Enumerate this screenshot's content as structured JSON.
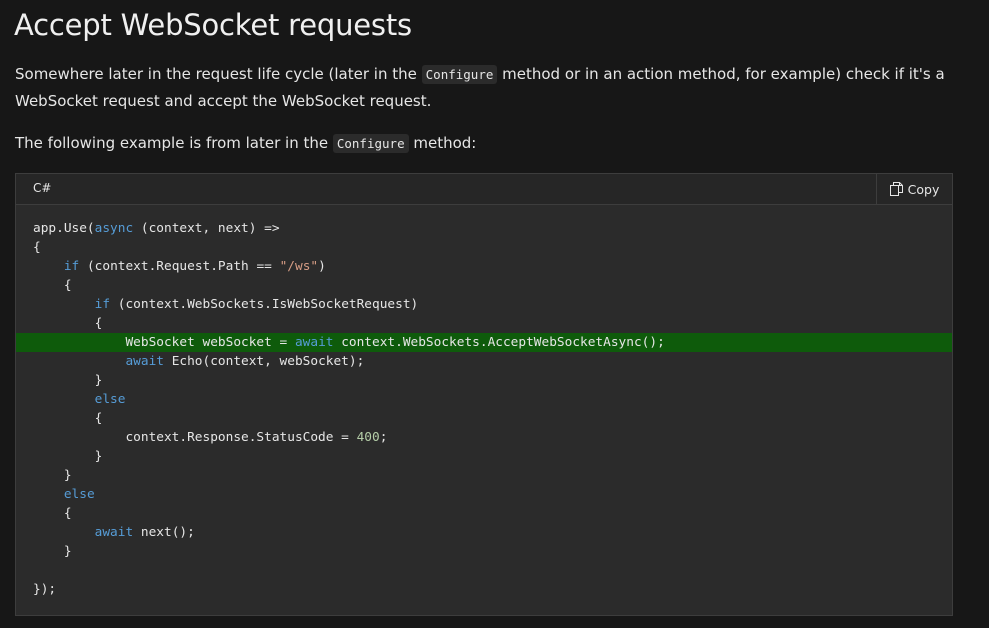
{
  "heading": "Accept WebSocket requests",
  "paragraphs": {
    "p1_before": "Somewhere later in the request life cycle (later in the ",
    "p1_code": "Configure",
    "p1_after": " method or in an action method, for example) check if it's a WebSocket request and accept the WebSocket request.",
    "p2_before": "The following example is from later in the ",
    "p2_code": "Configure",
    "p2_after": " method:"
  },
  "code_block": {
    "language": "C#",
    "copy_label": "Copy",
    "highlighted_line": 7,
    "lines": [
      [
        {
          "t": "app.Use("
        },
        {
          "t": "async",
          "c": "kw"
        },
        {
          "t": " (context, next) =>"
        }
      ],
      [
        {
          "t": "{"
        }
      ],
      [
        {
          "t": "    "
        },
        {
          "t": "if",
          "c": "kw"
        },
        {
          "t": " (context.Request.Path == "
        },
        {
          "t": "\"/ws\"",
          "c": "str"
        },
        {
          "t": ")"
        }
      ],
      [
        {
          "t": "    {"
        }
      ],
      [
        {
          "t": "        "
        },
        {
          "t": "if",
          "c": "kw"
        },
        {
          "t": " (context.WebSockets.IsWebSocketRequest)"
        }
      ],
      [
        {
          "t": "        {"
        }
      ],
      [
        {
          "t": "            WebSocket webSocket = "
        },
        {
          "t": "await",
          "c": "kw"
        },
        {
          "t": " context.WebSockets.AcceptWebSocketAsync();"
        }
      ],
      [
        {
          "t": "            "
        },
        {
          "t": "await",
          "c": "kw"
        },
        {
          "t": " Echo(context, webSocket);"
        }
      ],
      [
        {
          "t": "        }"
        }
      ],
      [
        {
          "t": "        "
        },
        {
          "t": "else",
          "c": "kw"
        }
      ],
      [
        {
          "t": "        {"
        }
      ],
      [
        {
          "t": "            context.Response.StatusCode = "
        },
        {
          "t": "400",
          "c": "num"
        },
        {
          "t": ";"
        }
      ],
      [
        {
          "t": "        }"
        }
      ],
      [
        {
          "t": "    }"
        }
      ],
      [
        {
          "t": "    "
        },
        {
          "t": "else",
          "c": "kw"
        }
      ],
      [
        {
          "t": "    {"
        }
      ],
      [
        {
          "t": "        "
        },
        {
          "t": "await",
          "c": "kw"
        },
        {
          "t": " next();"
        }
      ],
      [
        {
          "t": "    }"
        }
      ],
      [
        {
          "t": ""
        }
      ],
      [
        {
          "t": "});"
        }
      ]
    ]
  },
  "colors": {
    "background": "#171717",
    "code_background": "#2b2b2b",
    "highlight": "#0e5b0b",
    "keyword": "#569cd6",
    "string": "#d69d85",
    "number": "#b5cea8"
  }
}
